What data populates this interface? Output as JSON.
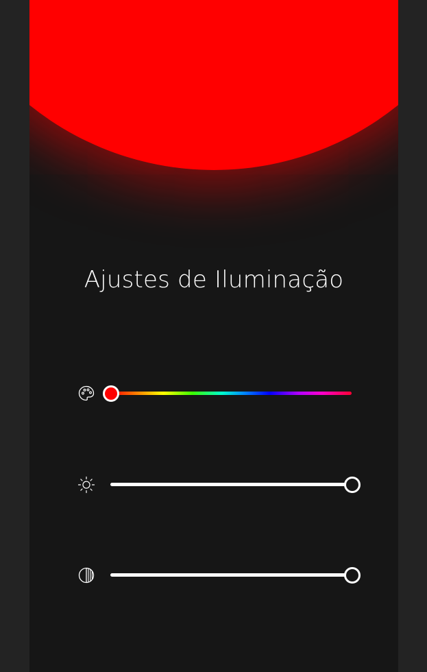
{
  "title": "Ajustes de Iluminação",
  "colors": {
    "background": "#232323",
    "panel": "#161616",
    "light_color": "#ff0000",
    "text": "#ffffff"
  },
  "sliders": [
    {
      "name": "hue",
      "icon": "palette-icon",
      "value": 0.0
    },
    {
      "name": "brightness",
      "icon": "sun-icon",
      "value": 1.0
    },
    {
      "name": "contrast",
      "icon": "contrast-icon",
      "value": 1.0
    }
  ]
}
